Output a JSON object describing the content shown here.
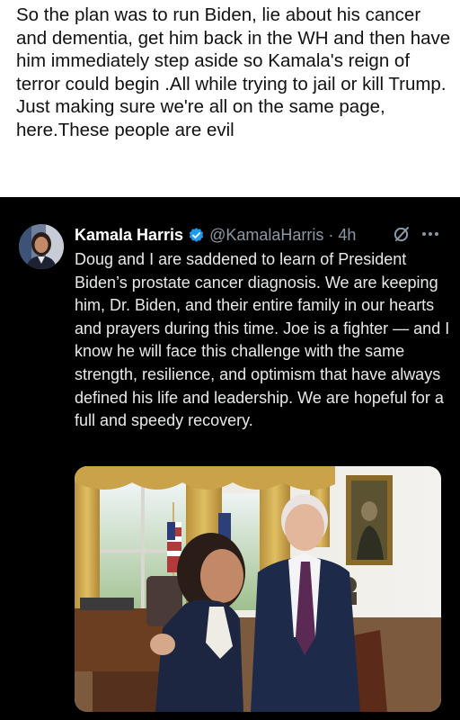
{
  "caption": {
    "paragraph1": "So the plan was to run Biden, lie about his cancer and dementia, get him back in the WH and then have him immediately step aside so Kamala's reign of terror could begin .All while trying to jail or kill Trump.",
    "paragraph2": "Just making sure we're all on the same page, here.These people are evil"
  },
  "tweet": {
    "author_name": "Kamala Harris",
    "handle": "@KamalaHarris",
    "separator": "·",
    "time": "4h",
    "text": "Doug and I are saddened to learn of President Biden’s prostate cancer diagnosis. We are keeping him, Dr. Biden, and their entire family in our hearts and prayers during this time. Joe is a fighter — and I know he will face this challenge with the same strength, resilience, and optimism that have always defined his life and leadership. We are hopeful for a full and speedy recovery.",
    "icons": {
      "verified": "verified-badge-icon",
      "grok": "grok-icon",
      "more": "more-options-icon"
    },
    "colors": {
      "background": "#000000",
      "text": "#e7e9ea",
      "secondary": "#8b98a5",
      "verified": "#1d9bf0"
    }
  }
}
